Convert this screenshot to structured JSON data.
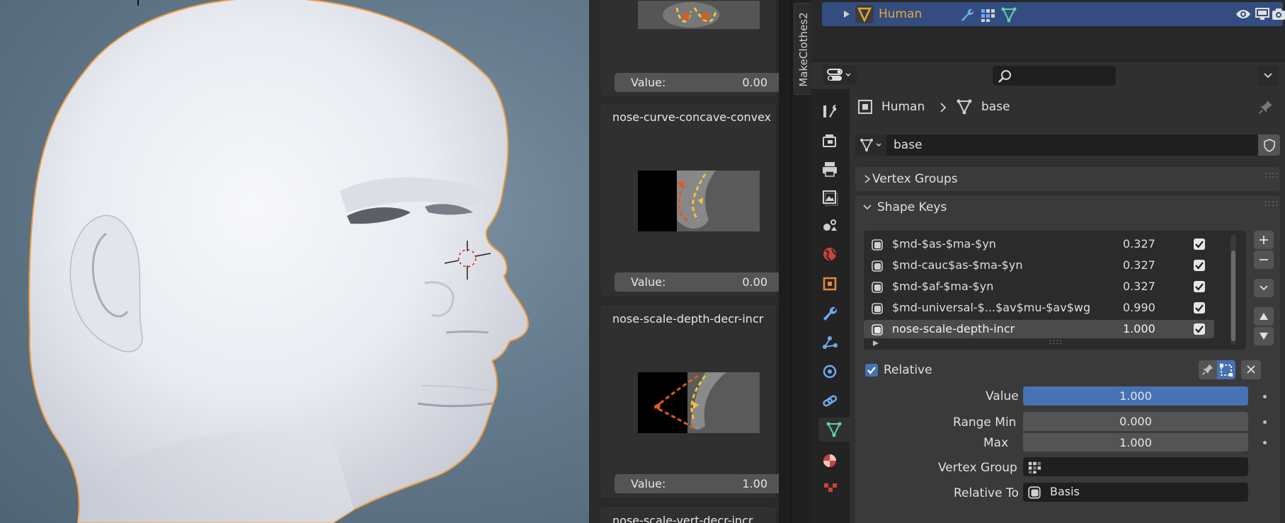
{
  "keys_panel": {
    "value_label": "Value:",
    "cards": [
      {
        "name": "",
        "value": "0.00"
      },
      {
        "name": "nose-curve-concave-convex",
        "value": "0.00"
      },
      {
        "name": "nose-scale-depth-decr-incr",
        "value": "1.00"
      },
      {
        "name": "nose-scale-vert-decr-incr",
        "value": ""
      }
    ]
  },
  "tab_strip": {
    "makeclothes_label": "MakeClothes2"
  },
  "outliner": {
    "object_name": "Human"
  },
  "properties": {
    "breadcrumb": {
      "object": "Human",
      "mesh": "base"
    },
    "mesh_datablock": "base",
    "panels": {
      "vertex_groups": "Vertex Groups",
      "shape_keys": "Shape Keys"
    },
    "shape_keys": [
      {
        "name": "$md-$as-$ma-$yn",
        "value": "0.327",
        "enabled": true
      },
      {
        "name": "$md-cauc$as-$ma-$yn",
        "value": "0.327",
        "enabled": true
      },
      {
        "name": "$md-$af-$ma-$yn",
        "value": "0.327",
        "enabled": true
      },
      {
        "name": "$md-universal-$...$av$mu-$av$wg",
        "value": "0.990",
        "enabled": true
      },
      {
        "name": "nose-scale-depth-incr",
        "value": "1.000",
        "enabled": true
      }
    ],
    "relative_label": "Relative",
    "value_label": "Value",
    "value": "1.000",
    "value_fraction": 1.0,
    "range_min_label": "Range Min",
    "range_min": "0.000",
    "max_label": "Max",
    "max": "1.000",
    "vertex_group_label": "Vertex Group",
    "relative_to_label": "Relative To",
    "relative_to": "Basis"
  },
  "colors": {
    "accent_blue": "#4772b3",
    "outliner_selected": "#334d80",
    "object_orange": "#e8a33d",
    "mesh_green": "#5fd3a0",
    "selection_outline": "#f29b3a"
  }
}
